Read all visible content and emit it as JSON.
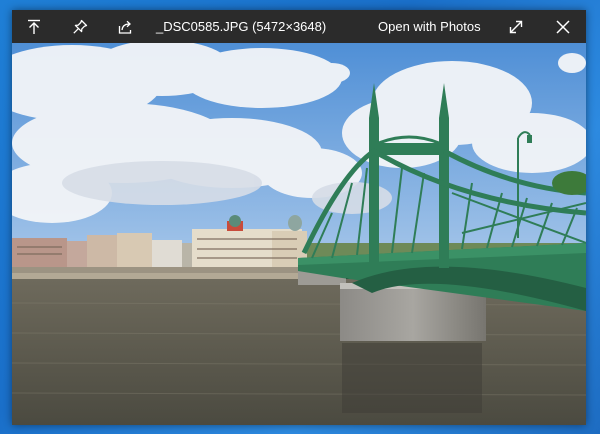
{
  "toolbar": {
    "filename": "_DSC0585.JPG (5472×3648)",
    "open_with_label": "Open with Photos",
    "icons": [
      "upload-icon",
      "pin-icon",
      "share-icon",
      "expand-icon",
      "close-icon"
    ]
  },
  "colors": {
    "toolbar_bg": "#2b2b2b",
    "desktop_blue": "#1f7fd6",
    "bridge_green": "#2f7d57"
  }
}
